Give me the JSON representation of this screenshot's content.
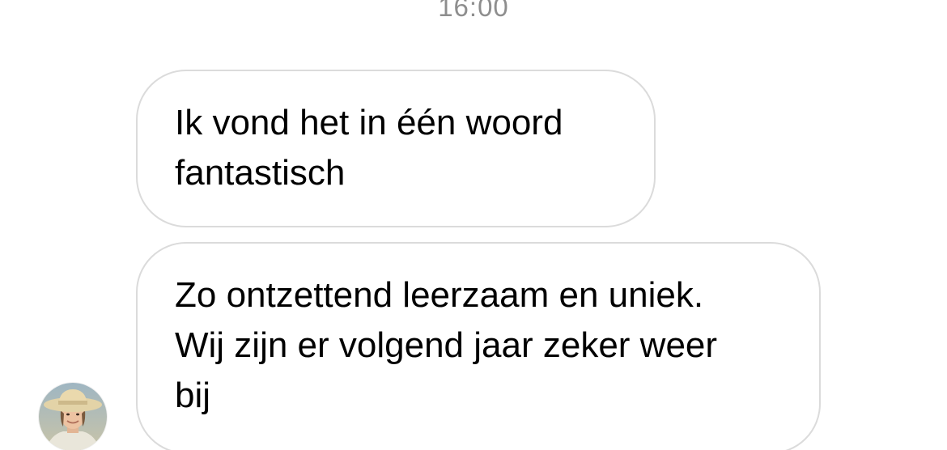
{
  "thread": {
    "timestamp": "16:00",
    "messages": [
      {
        "text": "Ik vond het in één woord\nfantastisch"
      },
      {
        "text": "Zo ontzettend leerzaam en uniek.\nWij zijn er volgend jaar zeker weer\nbij"
      }
    ]
  },
  "sender": {
    "avatar_icon": "avatar-photo-icon"
  }
}
